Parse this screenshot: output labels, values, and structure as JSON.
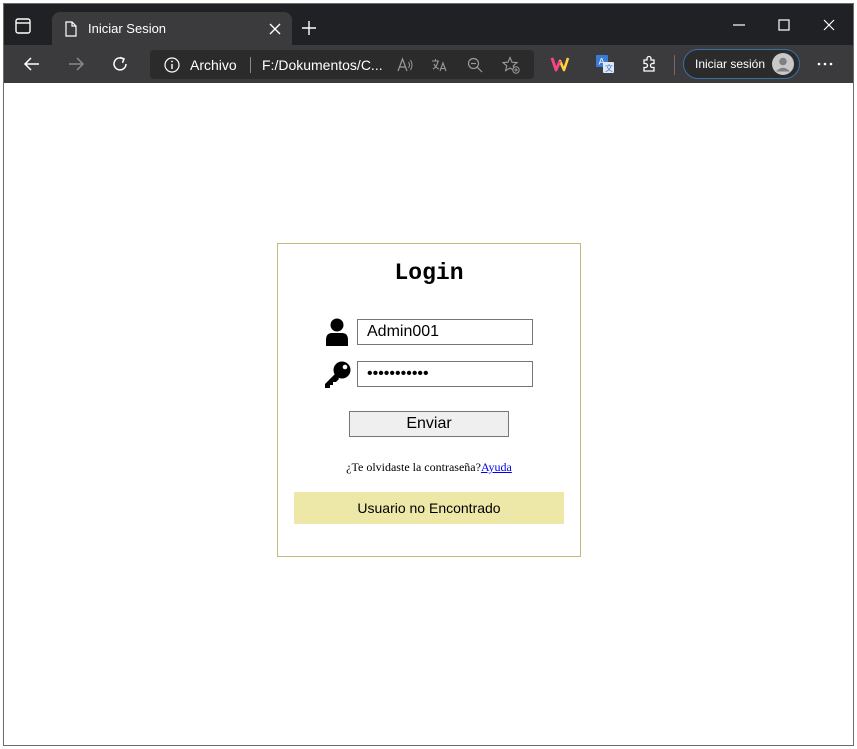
{
  "browser": {
    "tab": {
      "title": "Iniciar Sesion"
    },
    "address": {
      "scheme": "Archivo",
      "url": "F:/Dokumentos/C..."
    },
    "profile": {
      "signin_label": "Iniciar sesión"
    }
  },
  "login": {
    "title": "Login",
    "username_value": "Admin001",
    "password_value": "•••••••••••",
    "submit_label": "Enviar",
    "forgot_text": "¿Te olvidaste la contraseña?",
    "help_link": "Ayuda",
    "error_message": "Usuario no Encontrado"
  },
  "colors": {
    "tabstrip_bg": "#202124",
    "toolbar_bg": "#3b3b3d",
    "box_border": "#c8b97a",
    "error_bg": "#eee8a8",
    "link": "#0000ee"
  }
}
